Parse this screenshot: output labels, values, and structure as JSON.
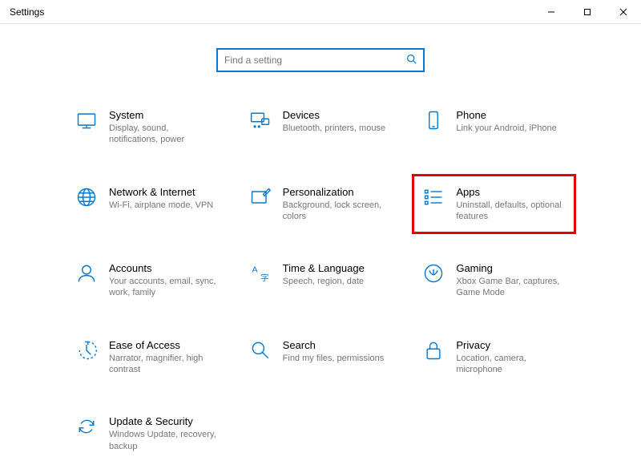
{
  "window": {
    "title": "Settings"
  },
  "search": {
    "placeholder": "Find a setting"
  },
  "items": [
    {
      "title": "System",
      "desc": "Display, sound, notifications, power"
    },
    {
      "title": "Devices",
      "desc": "Bluetooth, printers, mouse"
    },
    {
      "title": "Phone",
      "desc": "Link your Android, iPhone"
    },
    {
      "title": "Network & Internet",
      "desc": "Wi-Fi, airplane mode, VPN"
    },
    {
      "title": "Personalization",
      "desc": "Background, lock screen, colors"
    },
    {
      "title": "Apps",
      "desc": "Uninstall, defaults, optional features"
    },
    {
      "title": "Accounts",
      "desc": "Your accounts, email, sync, work, family"
    },
    {
      "title": "Time & Language",
      "desc": "Speech, region, date"
    },
    {
      "title": "Gaming",
      "desc": "Xbox Game Bar, captures, Game Mode"
    },
    {
      "title": "Ease of Access",
      "desc": "Narrator, magnifier, high contrast"
    },
    {
      "title": "Search",
      "desc": "Find my files, permissions"
    },
    {
      "title": "Privacy",
      "desc": "Location, camera, microphone"
    },
    {
      "title": "Update & Security",
      "desc": "Windows Update, recovery, backup"
    }
  ]
}
